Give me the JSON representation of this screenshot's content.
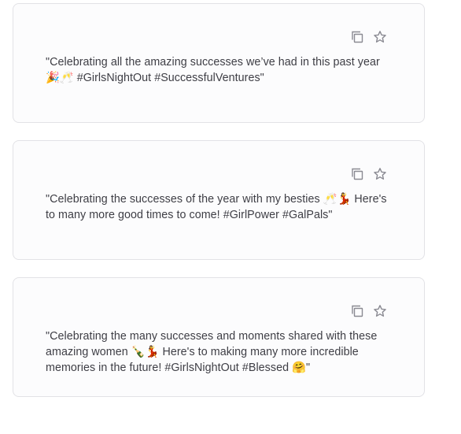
{
  "posts": [
    {
      "text": "\"Celebrating all the amazing successes we’ve had in this past year 🎉🥂 #GirlsNightOut #SuccessfulVentures\"",
      "copy_icon": "copy-icon",
      "star_icon": "star-icon"
    },
    {
      "text": "\"Celebrating the successes of the year with my besties 🥂💃 Here's to many more good times to come! #GirlPower #GalPals\"",
      "copy_icon": "copy-icon",
      "star_icon": "star-icon"
    },
    {
      "text": "\"Celebrating the many successes and moments shared with these amazing women 🍾💃 Here's to making many more incredible memories in the future! #GirlsNightOut #Blessed 🤗\"",
      "copy_icon": "copy-icon",
      "star_icon": "star-icon"
    }
  ],
  "colors": {
    "card_border": "#e2e2e6",
    "card_bg": "#fcfcfd",
    "text": "#3e3e45",
    "icon": "#8a8a92"
  }
}
